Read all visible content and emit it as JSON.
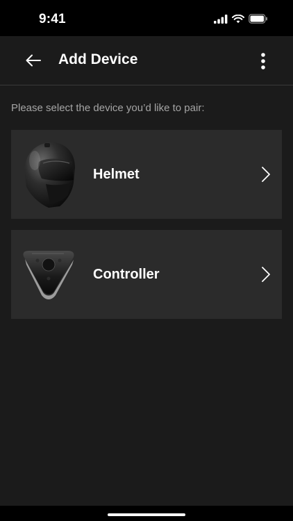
{
  "status_bar": {
    "time": "9:41",
    "icons": [
      "signal-icon",
      "wifi-icon",
      "battery-icon"
    ]
  },
  "header": {
    "title": "Add Device",
    "back_icon": "arrow-left-icon",
    "menu_icon": "more-vertical-icon"
  },
  "instruction": "Please select the device you’d like to pair:",
  "devices": [
    {
      "label": "Helmet",
      "icon": "helmet-image",
      "chevron": "chevron-right-icon"
    },
    {
      "label": "Controller",
      "icon": "controller-image",
      "chevron": "chevron-right-icon"
    }
  ],
  "colors": {
    "background": "#1b1b1b",
    "card": "#2b2b2b",
    "status_bar": "#000000",
    "text_primary": "#ffffff",
    "text_secondary": "#a5a5a5",
    "divider": "#3b3b3b"
  }
}
